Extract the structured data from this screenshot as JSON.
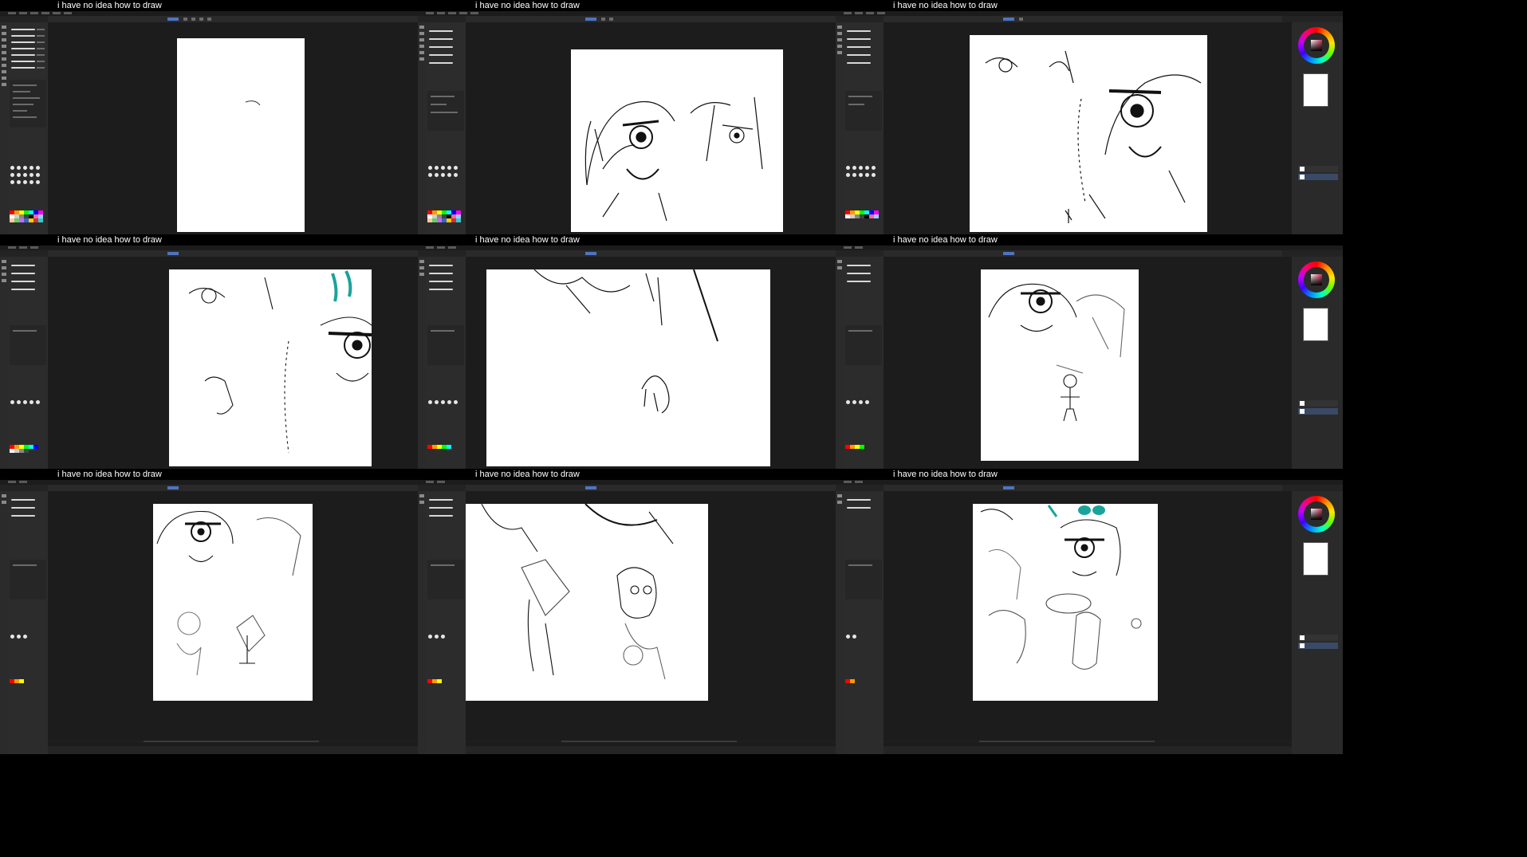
{
  "caption": "i have no idea how to draw",
  "frames": [
    {
      "id": 1
    },
    {
      "id": 2
    },
    {
      "id": 3
    },
    {
      "id": 4
    },
    {
      "id": 5
    },
    {
      "id": 6
    },
    {
      "id": 7
    },
    {
      "id": 8
    },
    {
      "id": 9
    }
  ],
  "icons": {
    "color_wheel": "color-wheel-icon",
    "brush_list": "brush-preset-icon",
    "layers": "layer-icon"
  },
  "colors": {
    "app_bg": "#232323",
    "workspace_bg": "#1c1c1c",
    "accent": "#4f74c0",
    "sketch_accent": "#1aa39a"
  }
}
